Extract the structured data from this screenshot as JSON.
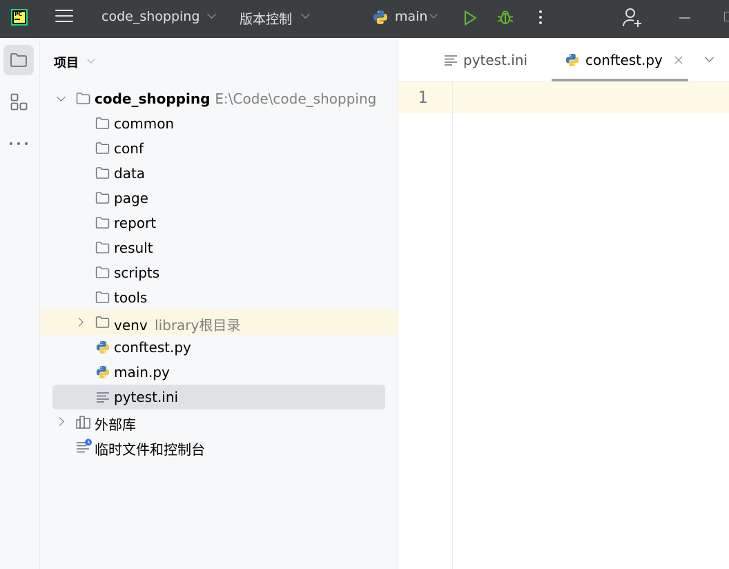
{
  "titlebar": {
    "project_name": "code_shopping",
    "vcs_label": "版本控制",
    "run_config": "main"
  },
  "project_panel": {
    "header": "项目",
    "root": {
      "name": "code_shopping",
      "path": "E:\\Code\\code_shopping"
    },
    "items": [
      {
        "label": "common",
        "type": "folder"
      },
      {
        "label": "conf",
        "type": "folder"
      },
      {
        "label": "data",
        "type": "folder"
      },
      {
        "label": "page",
        "type": "folder"
      },
      {
        "label": "report",
        "type": "folder"
      },
      {
        "label": "result",
        "type": "folder"
      },
      {
        "label": "scripts",
        "type": "folder"
      },
      {
        "label": "tools",
        "type": "folder"
      },
      {
        "label": "venv",
        "hint": "library根目录",
        "type": "folder"
      },
      {
        "label": "conftest.py",
        "type": "python"
      },
      {
        "label": "main.py",
        "type": "python"
      },
      {
        "label": "pytest.ini",
        "type": "text"
      }
    ],
    "external_libraries": "外部库",
    "scratches": "临时文件和控制台"
  },
  "editor": {
    "tabs": [
      {
        "label": "pytest.ini",
        "icon": "text-file-icon"
      },
      {
        "label": "conftest.py",
        "icon": "python-file-icon",
        "active": true
      }
    ],
    "line_numbers": [
      "1"
    ]
  },
  "colors": {
    "titlebar_bg": "#3c3f41",
    "selection_bg": "#dfe1e5",
    "highlight_row_bg": "#fdf6e3",
    "caret_line_bg": "#fefae6",
    "run_green": "#5fb832"
  }
}
